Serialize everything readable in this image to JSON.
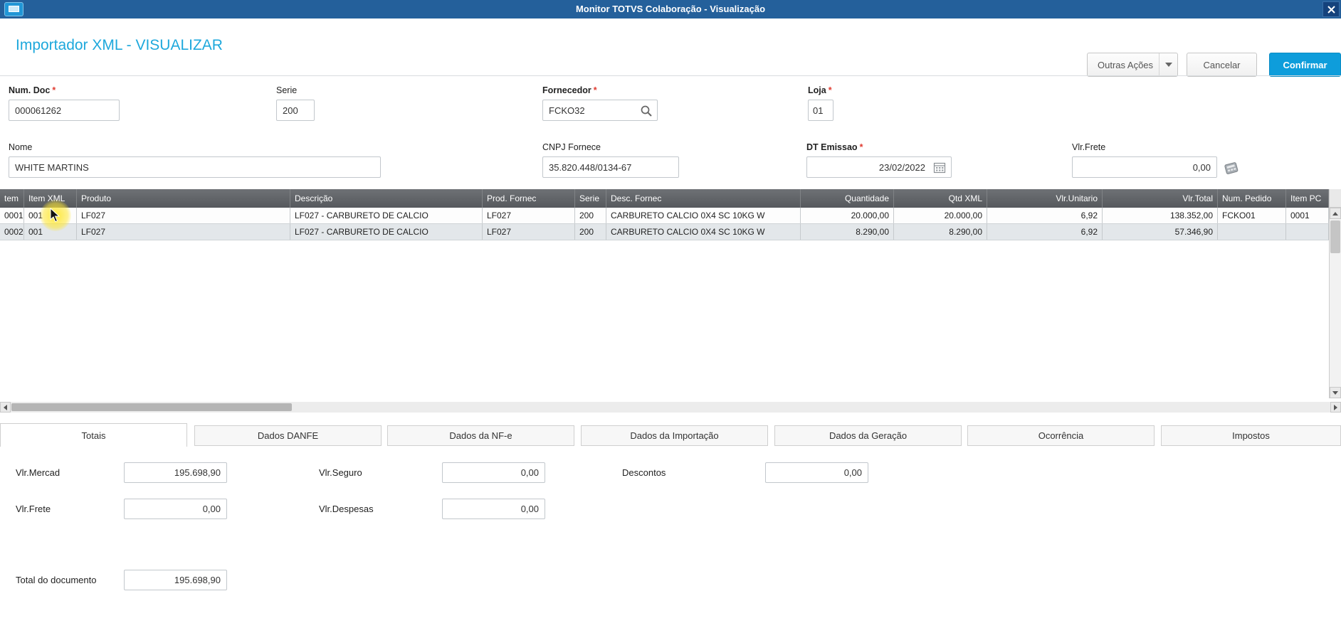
{
  "titlebar": {
    "title": "Monitor TOTVS Colaboração - Visualização"
  },
  "header": {
    "title": "Importador XML - VISUALIZAR",
    "buttons": {
      "outras_acoes": "Outras Ações",
      "cancelar": "Cancelar",
      "confirmar": "Confirmar"
    }
  },
  "form": {
    "required_marker": "*",
    "num_doc": {
      "label": "Num. Doc",
      "value": "000061262"
    },
    "serie": {
      "label": "Serie",
      "value": "200"
    },
    "fornecedor": {
      "label": "Fornecedor",
      "value": "FCKO32"
    },
    "loja": {
      "label": "Loja",
      "value": "01"
    },
    "nome": {
      "label": "Nome",
      "value": "WHITE MARTINS"
    },
    "cnpj_fornece": {
      "label": "CNPJ Fornece",
      "value": "35.820.448/0134-67"
    },
    "dt_emissao": {
      "label": "DT Emissao",
      "value": "23/02/2022"
    },
    "vlr_frete": {
      "label": "Vlr.Frete",
      "value": "0,00"
    }
  },
  "grid": {
    "columns": [
      "tem",
      "Item XML",
      "Produto",
      "Descrição",
      "Prod. Fornec",
      "Serie",
      "Desc. Fornec",
      "Quantidade",
      "Qtd XML",
      "Vlr.Unitario",
      "Vlr.Total",
      "Num. Pedido",
      "Item PC"
    ],
    "rows": [
      [
        "0001",
        "001",
        "LF027",
        "LF027 - CARBURETO DE CALCIO",
        "LF027",
        "200",
        "CARBURETO CALCIO 0X4 SC 10KG W",
        "20.000,00",
        "20.000,00",
        "6,92",
        "138.352,00",
        "FCKO01",
        "0001"
      ],
      [
        "0002",
        "001",
        "LF027",
        "LF027 - CARBURETO DE CALCIO",
        "LF027",
        "200",
        "CARBURETO CALCIO 0X4 SC 10KG W",
        "8.290,00",
        "8.290,00",
        "6,92",
        "57.346,90",
        "",
        ""
      ]
    ]
  },
  "tabs": [
    "Totais",
    "Dados DANFE",
    "Dados da NF-e",
    "Dados da Importação",
    "Dados da Geração",
    "Ocorrência",
    "Impostos"
  ],
  "totals": {
    "vlr_mercad": {
      "label": "Vlr.Mercad",
      "value": "195.698,90"
    },
    "vlr_seguro": {
      "label": "Vlr.Seguro",
      "value": "0,00"
    },
    "descontos": {
      "label": "Descontos",
      "value": "0,00"
    },
    "vlr_frete": {
      "label": "Vlr.Frete",
      "value": "0,00"
    },
    "vlr_despesas": {
      "label": "Vlr.Despesas",
      "value": "0,00"
    },
    "total_documento": {
      "label": "Total do documento",
      "value": "195.698,90"
    }
  },
  "colors": {
    "titlebar_bg": "#24609b",
    "accent_blue": "#1ea8dc",
    "confirm_button": "#0e9ddb",
    "grid_header_bg": "#5a5d61",
    "required_asterisk": "#e03c31",
    "row_alt_bg": "#e3e7ea",
    "cursor_highlight": "#ffe733"
  }
}
